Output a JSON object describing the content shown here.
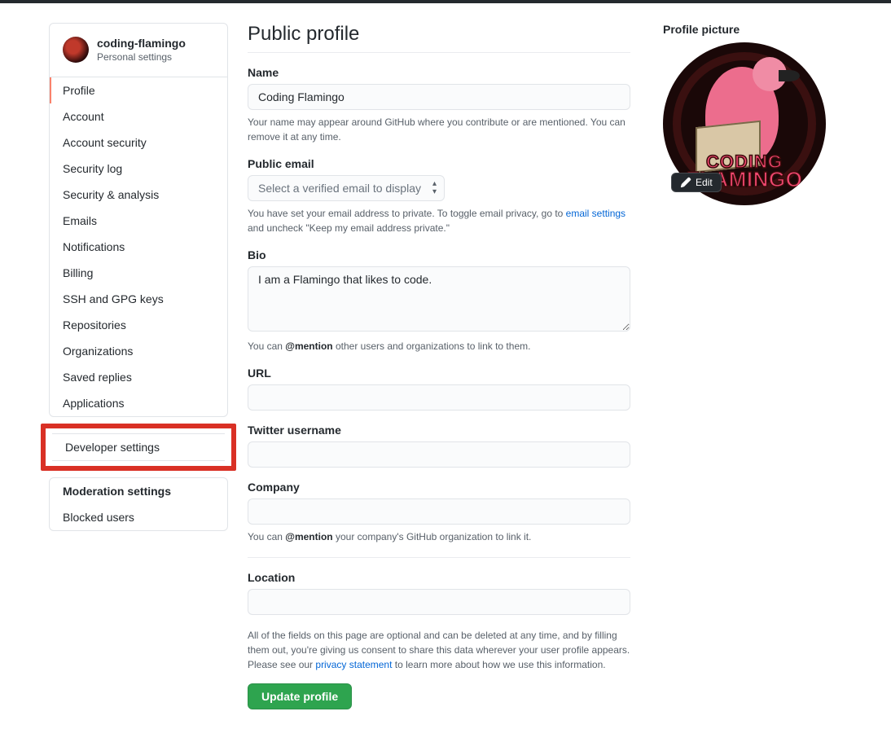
{
  "sidebar": {
    "user": "coding-flamingo",
    "subtitle": "Personal settings",
    "items": [
      {
        "label": "Profile",
        "selected": true
      },
      {
        "label": "Account"
      },
      {
        "label": "Account security"
      },
      {
        "label": "Security log"
      },
      {
        "label": "Security & analysis"
      },
      {
        "label": "Emails"
      },
      {
        "label": "Notifications"
      },
      {
        "label": "Billing"
      },
      {
        "label": "SSH and GPG keys"
      },
      {
        "label": "Repositories"
      },
      {
        "label": "Organizations"
      },
      {
        "label": "Saved replies"
      },
      {
        "label": "Applications"
      }
    ],
    "developer_item": {
      "label": "Developer settings"
    },
    "moderation_heading": "Moderation settings",
    "moderation_items": [
      {
        "label": "Blocked users"
      }
    ]
  },
  "page": {
    "title": "Public profile",
    "name_label": "Name",
    "name_value": "Coding Flamingo",
    "name_note": "Your name may appear around GitHub where you contribute or are mentioned. You can remove it at any time.",
    "email_label": "Public email",
    "email_placeholder": "Select a verified email to display",
    "email_note_pre": "You have set your email address to private. To toggle email privacy, go to ",
    "email_note_link": "email settings",
    "email_note_post": " and uncheck \"Keep my email address private.\"",
    "bio_label": "Bio",
    "bio_value": "I am a Flamingo that likes to code.",
    "bio_note_pre": "You can ",
    "bio_note_strong": "@mention",
    "bio_note_post": " other users and organizations to link to them.",
    "url_label": "URL",
    "url_value": "",
    "twitter_label": "Twitter username",
    "twitter_value": "",
    "company_label": "Company",
    "company_value": "",
    "company_note_pre": "You can ",
    "company_note_strong": "@mention",
    "company_note_post": " your company's GitHub organization to link it.",
    "location_label": "Location",
    "location_value": "",
    "disclaimer_pre": "All of the fields on this page are optional and can be deleted at any time, and by filling them out, you're giving us consent to share this data wherever your user profile appears. Please see our ",
    "disclaimer_link": "privacy statement",
    "disclaimer_post": " to learn more about how we use this information.",
    "submit_label": "Update profile"
  },
  "picture": {
    "label": "Profile picture",
    "edit_label": "Edit",
    "wordmark_line1": "CODING",
    "wordmark_line2": "FLAMINGO"
  }
}
